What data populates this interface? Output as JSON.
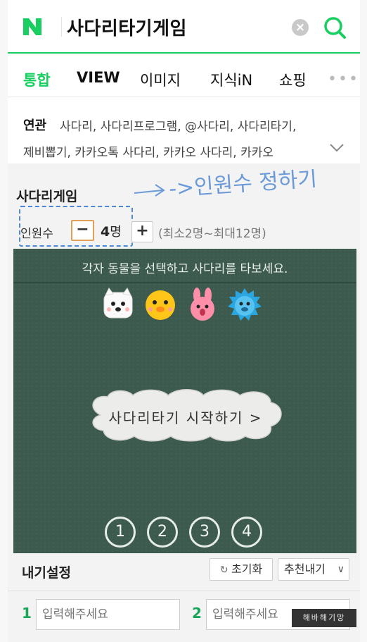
{
  "search": {
    "query": "사다리타기게임",
    "clear_icon": "clear-icon",
    "search_icon": "search-icon",
    "brand_color": "#19ce60"
  },
  "tabs": [
    {
      "label": "통합",
      "active": true
    },
    {
      "label": "VIEW"
    },
    {
      "label": "이미지"
    },
    {
      "label": "지식iN"
    },
    {
      "label": "쇼핑"
    }
  ],
  "related": {
    "label": "연관",
    "line1": "사다리, 사다리프로그램, @사다리, 사다리타기,",
    "line2": "제비뽑기, 카카오톡 사다리, 카카오 사다리, 카카오"
  },
  "ladder": {
    "title": "사다리게임",
    "annotation": "->인원수 정하기",
    "count_label": "인원수",
    "minus": "−",
    "plus": "+",
    "count_value": "4",
    "count_unit": "명",
    "range": "(최소2명~최대12명)",
    "instruction": "각자 동물을 선택하고 사다리를 타보세요.",
    "start_label": "사다리타기 시작하기 >",
    "numbers": [
      "1",
      "2",
      "3",
      "4"
    ]
  },
  "settings": {
    "title": "내기설정",
    "reset": "초기화",
    "reset_icon": "refresh-icon",
    "recommend": "추천내기",
    "inputs": [
      {
        "num": "1",
        "placeholder": "입력해주세요"
      },
      {
        "num": "2",
        "placeholder": "입력해주세요"
      }
    ]
  },
  "watermark": "해바해기망"
}
